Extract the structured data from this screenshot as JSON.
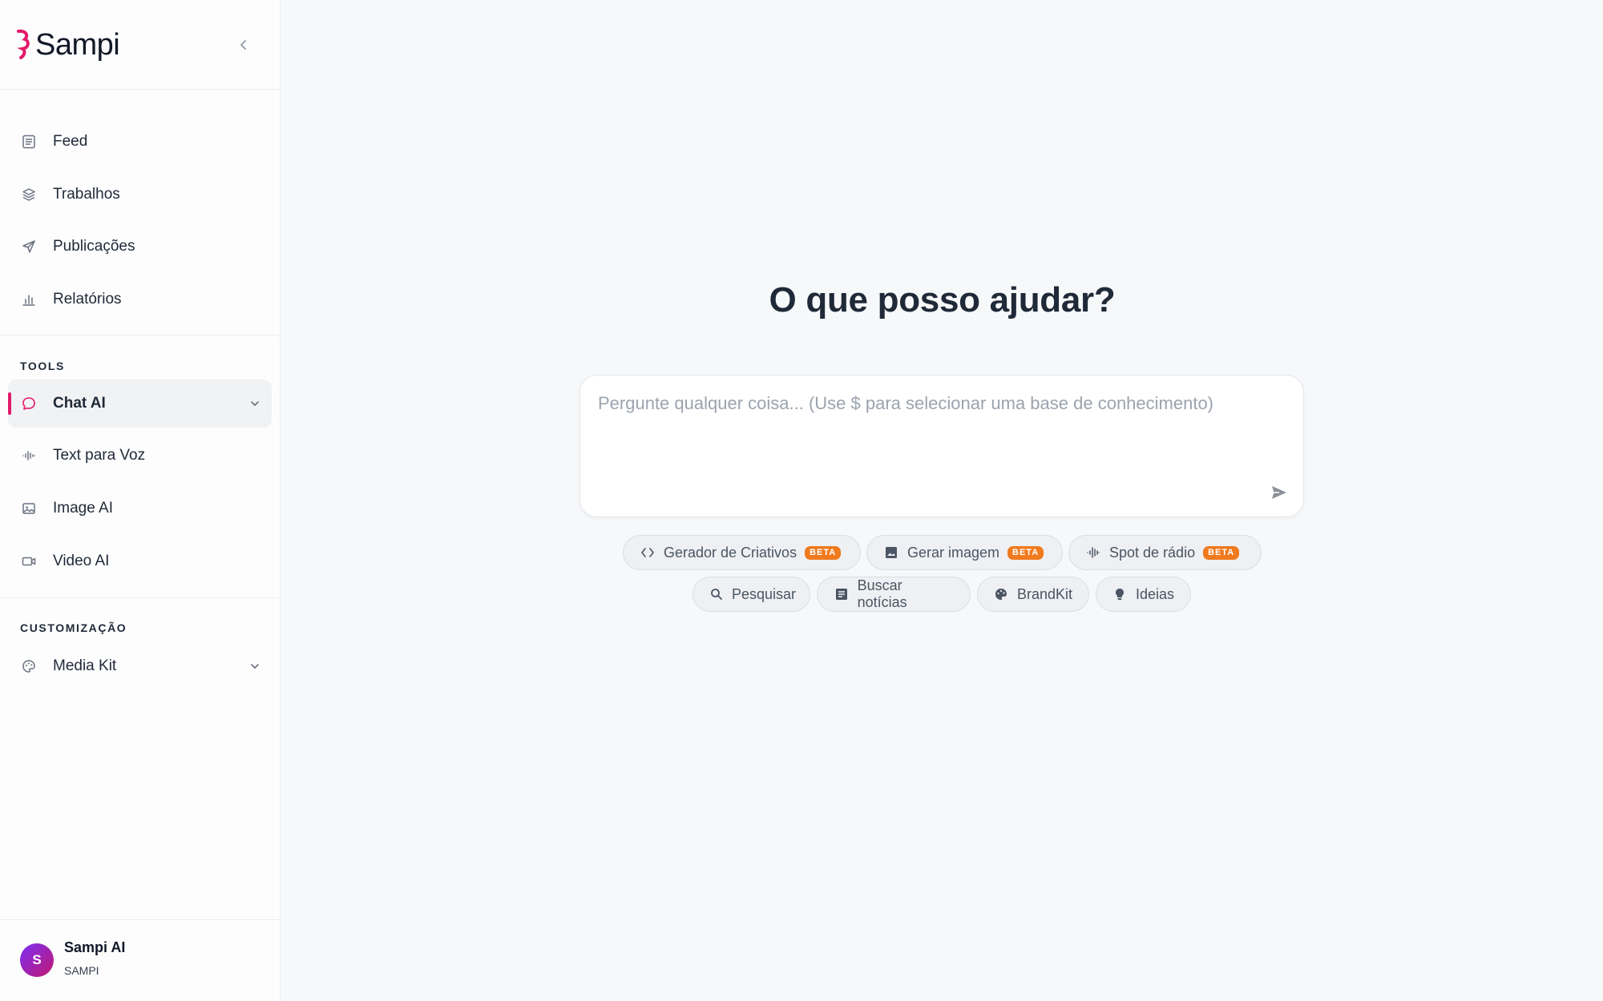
{
  "brand": {
    "name": "Sampi",
    "accent": "#e21b6b"
  },
  "nav": {
    "main": [
      {
        "label": "Feed",
        "icon": "feed-icon"
      },
      {
        "label": "Trabalhos",
        "icon": "layers-icon"
      },
      {
        "label": "Publicações",
        "icon": "send-icon"
      },
      {
        "label": "Relatórios",
        "icon": "bar-chart-icon"
      }
    ],
    "tools_title": "TOOLS",
    "tools": [
      {
        "label": "Chat AI",
        "icon": "chat-bubble-icon",
        "active": true
      },
      {
        "label": "Text para Voz",
        "icon": "audio-wave-icon"
      },
      {
        "label": "Image AI",
        "icon": "image-icon"
      },
      {
        "label": "Video AI",
        "icon": "video-camera-icon"
      }
    ],
    "custom_title": "CUSTOMIZAÇÃO",
    "custom": [
      {
        "label": "Media Kit",
        "icon": "palette-icon"
      }
    ]
  },
  "user": {
    "initial": "S",
    "name": "Sampi AI",
    "org": "SAMPI"
  },
  "main": {
    "headline": "O que posso ajudar?",
    "prompt_placeholder": "Pergunte qualquer coisa... (Use $ para selecionar uma base de conhecimento)",
    "chips_row1": [
      {
        "label": "Gerador de Criativos",
        "icon": "code-icon",
        "badge": "BETA"
      },
      {
        "label": "Gerar imagem",
        "icon": "image-icon",
        "badge": "BETA"
      },
      {
        "label": "Spot de rádio",
        "icon": "audio-wave-icon",
        "badge": "BETA"
      }
    ],
    "chips_row2": [
      {
        "label": "Pesquisar",
        "icon": "search-icon"
      },
      {
        "label": "Buscar notícias",
        "icon": "news-icon"
      },
      {
        "label": "BrandKit",
        "icon": "palette-icon"
      },
      {
        "label": "Ideias",
        "icon": "lightbulb-icon"
      }
    ]
  }
}
